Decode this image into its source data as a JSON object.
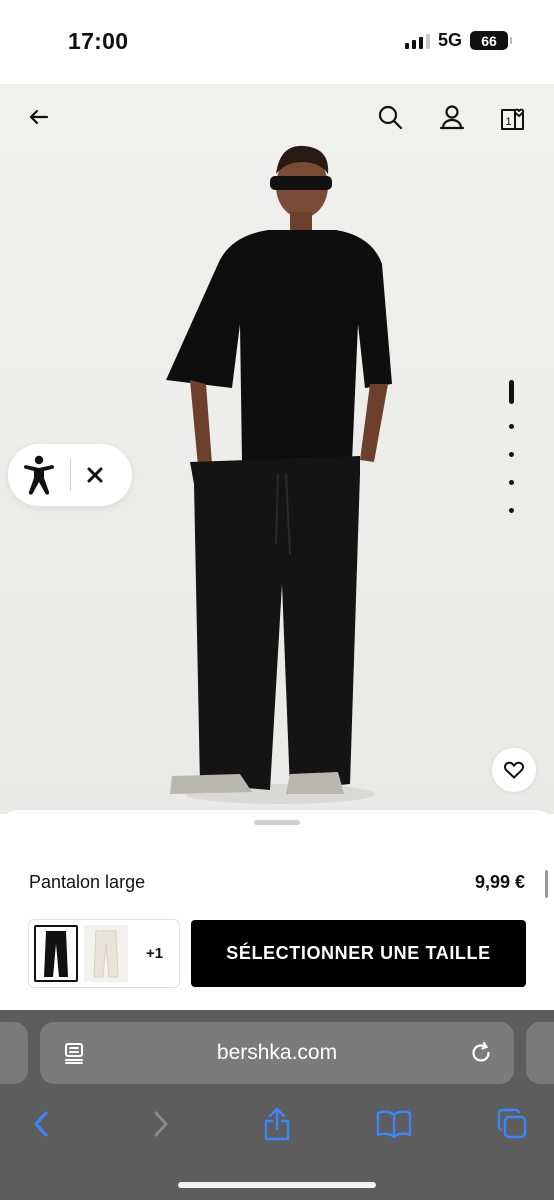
{
  "status_bar": {
    "time": "17:00",
    "network": "5G",
    "battery": "66"
  },
  "header": {
    "back_icon": "arrow-left-icon",
    "search_icon": "search-icon",
    "account_icon": "user-icon",
    "cart_icon": "bag-heart-icon",
    "cart_count": "1"
  },
  "gallery": {
    "image_count": 5,
    "active_index": 0
  },
  "accessibility": {
    "icon": "accessibility-person-icon",
    "close_icon": "close-icon"
  },
  "product": {
    "name": "Pantalon large",
    "price": "9,99 €",
    "colors_more": "+1",
    "select_size_label": "SÉLECTIONNER UNE TAILLE",
    "favorite_icon": "heart-icon"
  },
  "browser": {
    "url": "bershka.com",
    "reader_icon": "reader-icon",
    "reload_icon": "reload-icon",
    "back_icon": "chevron-left-icon",
    "forward_icon": "chevron-right-icon",
    "share_icon": "share-icon",
    "bookmarks_icon": "book-icon",
    "tabs_icon": "tabs-icon",
    "accent_color": "#3a86ff"
  }
}
